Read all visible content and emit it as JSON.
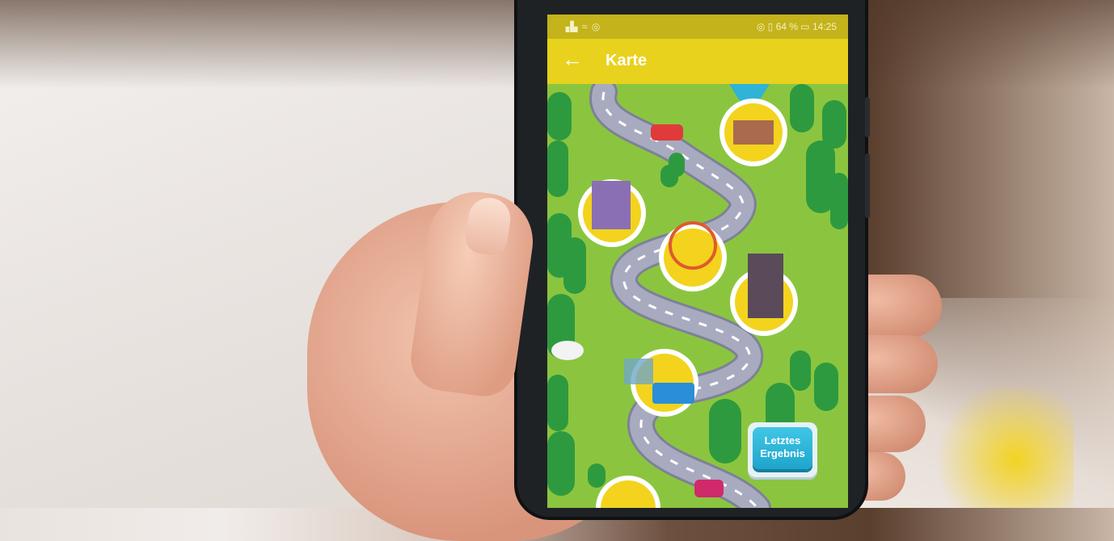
{
  "status_bar": {
    "left_icons": "▗▙ ≈ ◎",
    "right": "◎ ▯ 64 % ▭ 14:25"
  },
  "app_bar": {
    "back_icon": "←",
    "title": "Karte"
  },
  "map": {
    "result_button": {
      "line1": "Letztes",
      "line2": "Ergebnis"
    }
  },
  "colors": {
    "app_bar": "#e8d21d",
    "grass": "#8bc53f",
    "road": "#9da0b4",
    "button": "#2bb4d8"
  }
}
